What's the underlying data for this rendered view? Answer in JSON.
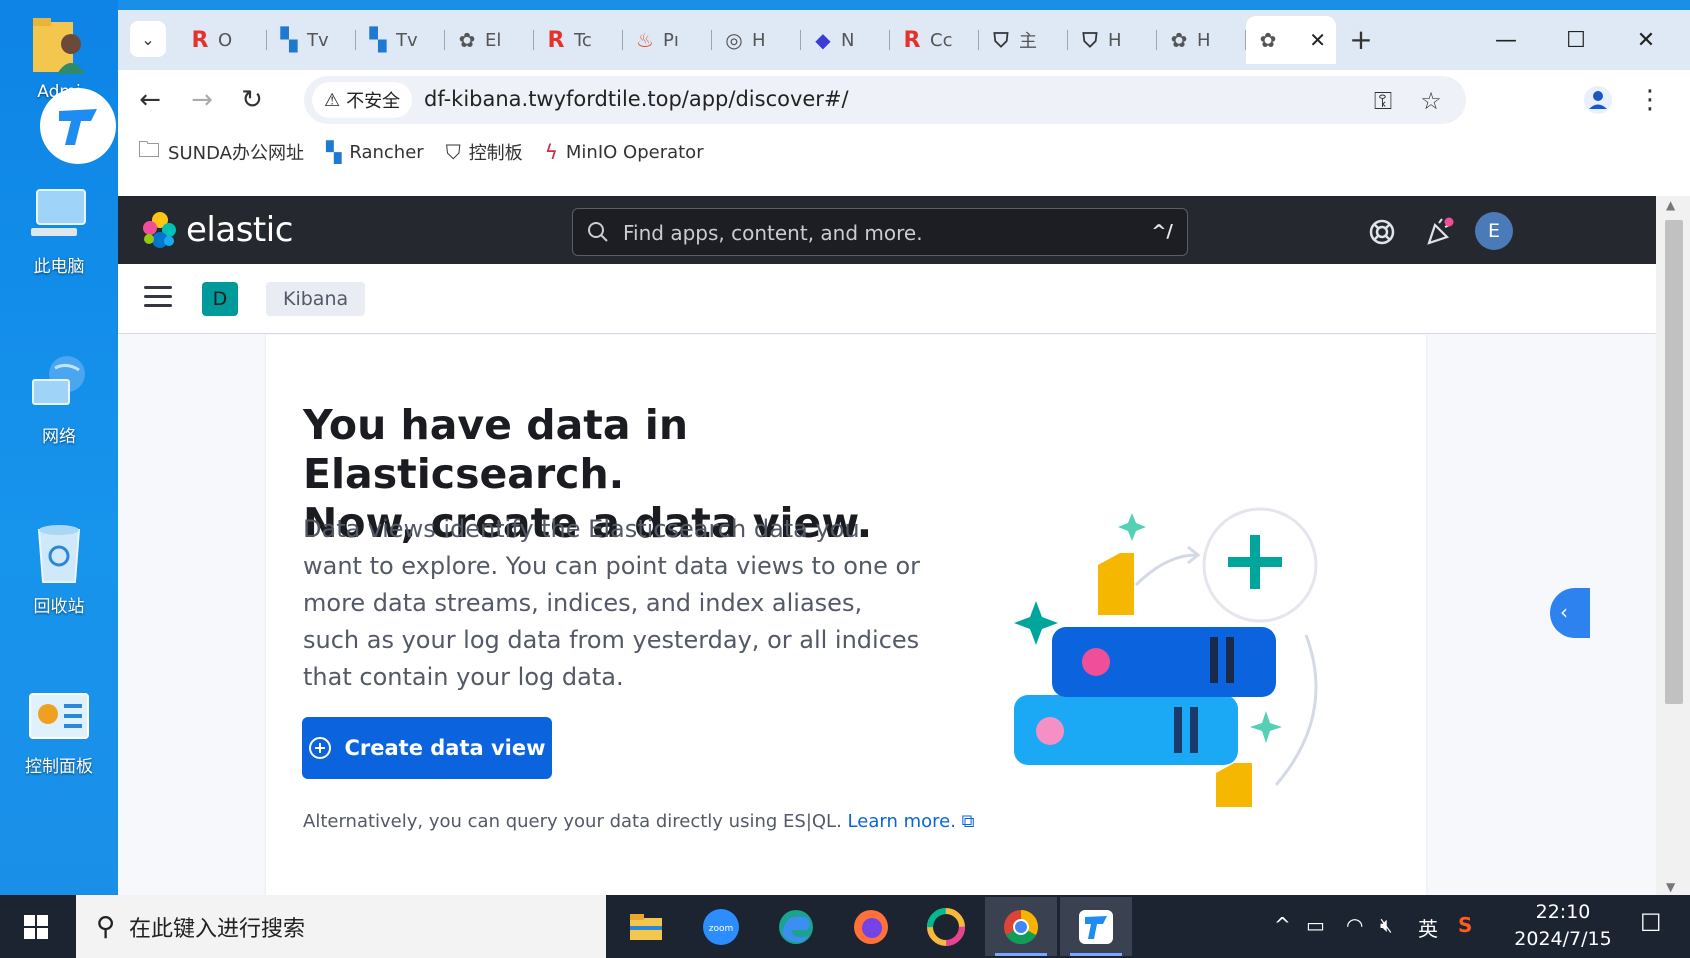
{
  "desktop": {
    "icons": [
      {
        "label": "Admi",
        "icon": "user-folder-icon"
      },
      {
        "label": "此电脑",
        "icon": "computer-icon"
      },
      {
        "label": "网络",
        "icon": "network-icon"
      },
      {
        "label": "回收站",
        "icon": "recycle-bin-icon"
      },
      {
        "label": "控制面板",
        "icon": "control-panel-icon"
      }
    ]
  },
  "browser": {
    "tabs": [
      {
        "short": "O",
        "icon": "rancher-r-icon",
        "color": "#e2342b"
      },
      {
        "short": "Tv",
        "icon": "rancher-cow-icon",
        "color": "#1f78d1"
      },
      {
        "short": "Tv",
        "icon": "rancher-cow-icon",
        "color": "#1f78d1"
      },
      {
        "short": "El",
        "icon": "elastic-icon",
        "color": "#555555"
      },
      {
        "short": "Tc",
        "icon": "rancher-r-icon",
        "color": "#e2342b"
      },
      {
        "short": "Pı",
        "icon": "prometheus-icon",
        "color": "#e6522c"
      },
      {
        "short": "H",
        "icon": "grafana-icon",
        "color": "#555555"
      },
      {
        "short": "N",
        "icon": "nacos-icon",
        "color": "#3b3bd6"
      },
      {
        "short": "Cc",
        "icon": "rancher-r-icon",
        "color": "#e2342b"
      },
      {
        "short": "主",
        "icon": "shield-icon",
        "color": "#333333"
      },
      {
        "short": "H",
        "icon": "shield-icon",
        "color": "#333333"
      },
      {
        "short": "H",
        "icon": "elastic-icon",
        "color": "#555555"
      },
      {
        "short": "",
        "icon": "elastic-icon",
        "color": "#555555",
        "active": true
      }
    ],
    "new_tab_symbol": "+",
    "security_label": "不安全",
    "url": "df-kibana.twyfordtile.top/app/discover#/",
    "bookmarks": [
      {
        "label": "SUNDA办公网址",
        "icon": "folder-icon"
      },
      {
        "label": "Rancher",
        "icon": "rancher-cow-icon"
      },
      {
        "label": "控制板",
        "icon": "shield-icon"
      },
      {
        "label": "MinIO Operator",
        "icon": "minio-icon"
      }
    ]
  },
  "kibana": {
    "brand": "elastic",
    "search_placeholder": "Find apps, content, and more.",
    "search_shortcut": "^/",
    "user_initial": "E",
    "space_initial": "D",
    "breadcrumb": "Kibana",
    "headline_1": "You have data in Elasticsearch.",
    "headline_2": "Now, create a data view.",
    "description": "Data views identify the Elasticsearch data you want to explore. You can point data views to one or more data streams, indices, and index aliases, such as your log data from yesterday, or all indices that contain your log data.",
    "cta_label": "Create data view",
    "alt_text": "Alternatively, you can query your data directly using ES|QL.",
    "learn_more": "Learn more.",
    "colors": {
      "header": "#25282f",
      "primary": "#0b64dd",
      "space": "#009a9a",
      "avatar": "#4a7bb8"
    }
  },
  "taskbar": {
    "search_placeholder": "在此键入进行搜索",
    "apps": [
      "file-explorer-icon",
      "zoom-icon",
      "edge-icon",
      "firefox-icon",
      "photos-icon",
      "chrome-icon",
      "todesk-icon"
    ],
    "ime": "英",
    "time": "22:10",
    "date": "2024/7/15"
  }
}
